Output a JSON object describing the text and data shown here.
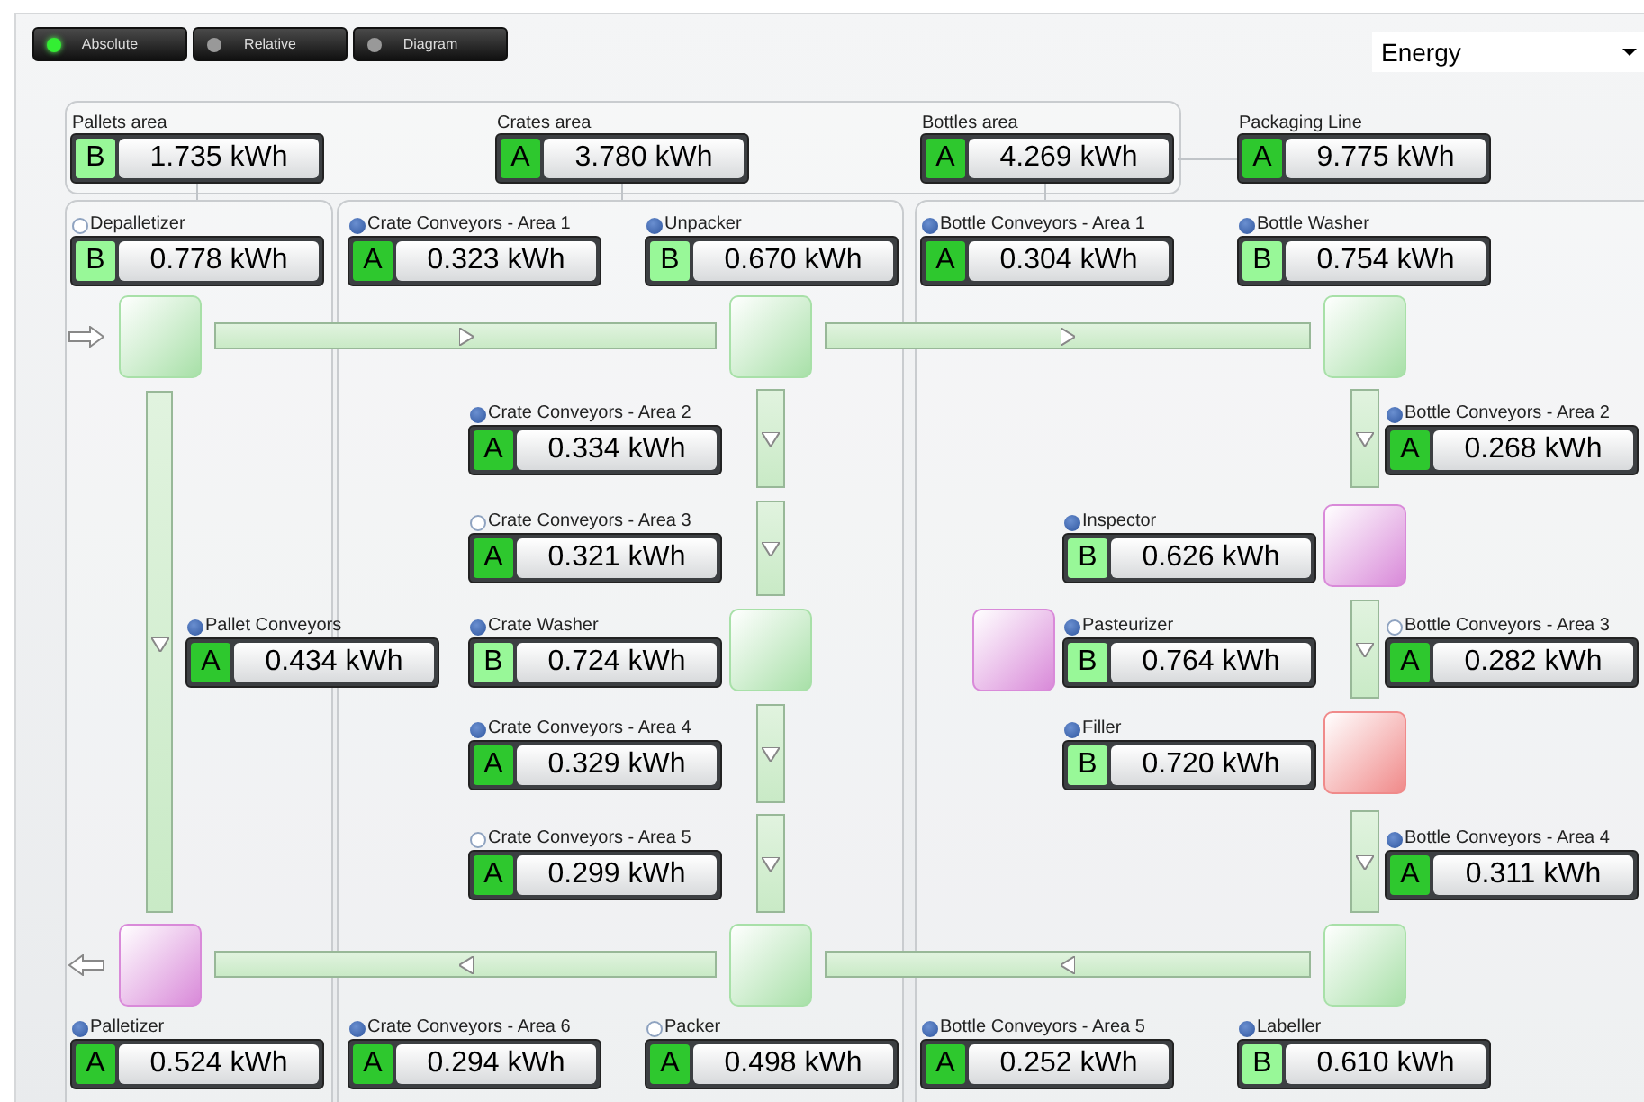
{
  "view_buttons": [
    {
      "label": "Absolute",
      "selected": true
    },
    {
      "label": "Relative",
      "selected": false
    },
    {
      "label": "Diagram",
      "selected": false
    }
  ],
  "metric_dropdown": {
    "value": "Energy"
  },
  "areas": [
    {
      "label": "Pallets area",
      "grade": "B",
      "value": "1.735 kWh"
    },
    {
      "label": "Crates area",
      "grade": "A",
      "value": "3.780 kWh"
    },
    {
      "label": "Bottles area",
      "grade": "A",
      "value": "4.269 kWh"
    },
    {
      "label": "Packaging Line",
      "grade": "A",
      "value": "9.775 kWh"
    }
  ],
  "machines": [
    {
      "label": "Depalletizer",
      "running": false,
      "grade": "B",
      "value": "0.778 kWh"
    },
    {
      "label": "Crate Conveyors - Area 1",
      "running": true,
      "grade": "A",
      "value": "0.323 kWh"
    },
    {
      "label": "Unpacker",
      "running": true,
      "grade": "B",
      "value": "0.670 kWh"
    },
    {
      "label": "Bottle Conveyors - Area 1",
      "running": true,
      "grade": "A",
      "value": "0.304 kWh"
    },
    {
      "label": "Bottle Washer",
      "running": true,
      "grade": "B",
      "value": "0.754 kWh"
    },
    {
      "label": "Crate Conveyors - Area 2",
      "running": true,
      "grade": "A",
      "value": "0.334 kWh"
    },
    {
      "label": "Bottle Conveyors - Area 2",
      "running": true,
      "grade": "A",
      "value": "0.268 kWh"
    },
    {
      "label": "Crate Conveyors - Area 3",
      "running": false,
      "grade": "A",
      "value": "0.321 kWh"
    },
    {
      "label": "Inspector",
      "running": true,
      "grade": "B",
      "value": "0.626 kWh"
    },
    {
      "label": "Pallet Conveyors",
      "running": true,
      "grade": "A",
      "value": "0.434 kWh"
    },
    {
      "label": "Crate Washer",
      "running": true,
      "grade": "B",
      "value": "0.724 kWh"
    },
    {
      "label": "Pasteurizer",
      "running": true,
      "grade": "B",
      "value": "0.764 kWh"
    },
    {
      "label": "Bottle Conveyors - Area 3",
      "running": false,
      "grade": "A",
      "value": "0.282 kWh"
    },
    {
      "label": "Crate Conveyors - Area 4",
      "running": true,
      "grade": "A",
      "value": "0.329 kWh"
    },
    {
      "label": "Filler",
      "running": true,
      "grade": "B",
      "value": "0.720 kWh"
    },
    {
      "label": "Crate Conveyors - Area 5",
      "running": false,
      "grade": "A",
      "value": "0.299 kWh"
    },
    {
      "label": "Bottle Conveyors - Area 4",
      "running": true,
      "grade": "A",
      "value": "0.311 kWh"
    },
    {
      "label": "Palletizer",
      "running": true,
      "grade": "A",
      "value": "0.524 kWh"
    },
    {
      "label": "Crate Conveyors - Area 6",
      "running": true,
      "grade": "A",
      "value": "0.294 kWh"
    },
    {
      "label": "Packer",
      "running": false,
      "grade": "A",
      "value": "0.498 kWh"
    },
    {
      "label": "Bottle Conveyors - Area 5",
      "running": true,
      "grade": "A",
      "value": "0.252 kWh"
    },
    {
      "label": "Labeller",
      "running": true,
      "grade": "B",
      "value": "0.610 kWh"
    }
  ],
  "units": [
    {
      "color": "#a8e0a8"
    },
    {
      "color": "#a8e0a8"
    },
    {
      "color": "#a8e0a8"
    },
    {
      "color": "#d98ad9"
    },
    {
      "color": "#a8e0a8"
    },
    {
      "color": "#d98ad9"
    },
    {
      "color": "#f08a8a"
    },
    {
      "color": "#d98ad9"
    },
    {
      "color": "#a8e0a8"
    },
    {
      "color": "#a8e0a8"
    }
  ],
  "conveyors": [
    {
      "kind": "right"
    },
    {
      "kind": "right"
    },
    {
      "kind": "left"
    },
    {
      "kind": "left"
    },
    {
      "kind": "down"
    },
    {
      "kind": "down"
    },
    {
      "kind": "down"
    },
    {
      "kind": "down"
    },
    {
      "kind": "down"
    },
    {
      "kind": "down"
    },
    {
      "kind": "down"
    },
    {
      "kind": "down"
    }
  ]
}
